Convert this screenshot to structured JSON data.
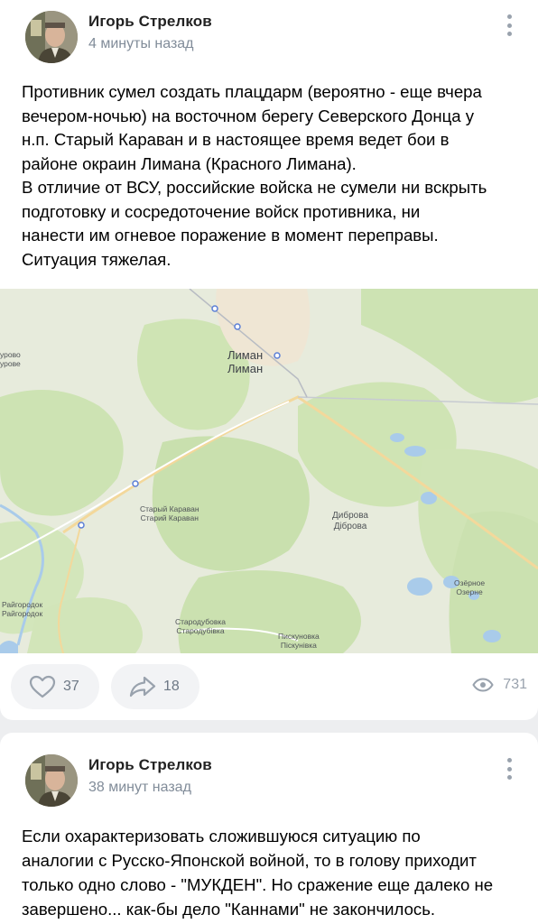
{
  "posts": [
    {
      "author": "Игорь Стрелков",
      "time": "4 минуты назад",
      "text": "Противник сумел создать плацдарм (вероятно - еще вчера\nвечером-ночью) на восточном берегу Северского Донца у\nн.п. Старый Караван и в настоящее время ведет бои в\nрайоне окраин Лимана (Красного Лимана).\nВ отличие от ВСУ, российские войска не сумели ни вскрыть\nподготовку и сосредоточение войск противника, ни\nнанести им огневое поражение в момент переправы.\nСитуация тяжелая.",
      "map": {
        "labels": {
          "liman": "Лиман",
          "liman2": "Лиман",
          "stary_karavan": "Старый Караван",
          "stary_karavan2": "Старий Караван",
          "dibrova": "Диброва",
          "dibrova2": "Діброва",
          "ozernoe": "Озёрное",
          "ozernoe2": "Озерне",
          "raigorodok": "Райгородок",
          "raigorodok2": "Райгородок",
          "starodubovka": "Стародубовка",
          "starodubovka2": "Стародубівка",
          "piskunovka": "Пискуновка",
          "piskunovka2": "Піскунівка",
          "edge_left": "урово",
          "edge_left2": "урове"
        }
      },
      "likes": "37",
      "shares": "18",
      "views": "731"
    },
    {
      "author": "Игорь Стрелков",
      "time": "38 минут назад",
      "text": "Если охарактеризовать сложившуюся ситуацию по\nаналогии с Русско-Японской войной, то в голову приходит\nтолько одно слово - \"МУКДЕН\". Но сражение еще далеко не\nзавершено... как-бы дело \"Каннами\" не закончилось."
    }
  ],
  "colors": {
    "background": "#edeef0",
    "card": "#ffffff",
    "secondary_text": "#818c99",
    "icon": "#99a2ad",
    "forest": "#cfe3b6",
    "water": "#a9cbea",
    "road": "#f4d9a0"
  },
  "icons": {
    "like": "heart-icon",
    "share": "share-arrow-icon",
    "views": "eye-icon",
    "more": "more-vertical-icon"
  }
}
